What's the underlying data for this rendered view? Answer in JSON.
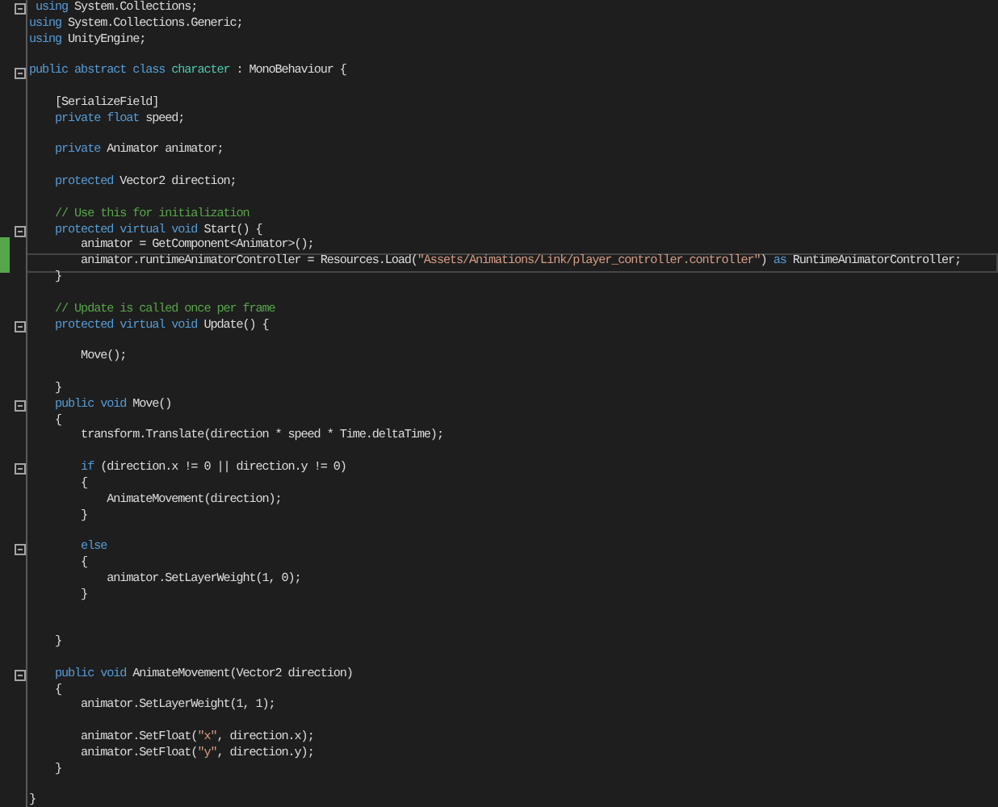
{
  "editor": {
    "lines": [
      {
        "tokens": [
          {
            "kind": "keyword",
            "text": " using"
          },
          {
            "kind": "plain",
            "text": " System.Collections;"
          }
        ],
        "foldable": true,
        "modified": false,
        "current": false
      },
      {
        "tokens": [
          {
            "kind": "keyword",
            "text": "using"
          },
          {
            "kind": "plain",
            "text": " System.Collections.Generic;"
          }
        ],
        "foldable": false,
        "modified": false,
        "current": false
      },
      {
        "tokens": [
          {
            "kind": "keyword",
            "text": "using"
          },
          {
            "kind": "plain",
            "text": " UnityEngine;"
          }
        ],
        "foldable": false,
        "modified": false,
        "current": false
      },
      {
        "foldable": false,
        "modified": false,
        "current": false
      },
      {
        "tokens": [
          {
            "kind": "keyword",
            "text": "public abstract class"
          },
          {
            "kind": "type",
            "text": " character"
          },
          {
            "kind": "plain",
            "text": " : MonoBehaviour {"
          }
        ],
        "foldable": true,
        "modified": false,
        "current": false
      },
      {
        "foldable": false,
        "modified": false,
        "current": false
      },
      {
        "tokens": [
          {
            "kind": "plain",
            "text": "    [SerializeField]"
          }
        ],
        "foldable": false,
        "modified": false,
        "current": false
      },
      {
        "tokens": [
          {
            "kind": "keyword",
            "text": "    private float"
          },
          {
            "kind": "plain",
            "text": " speed;"
          }
        ],
        "foldable": false,
        "modified": false,
        "current": false
      },
      {
        "foldable": false,
        "modified": false,
        "current": false
      },
      {
        "tokens": [
          {
            "kind": "keyword",
            "text": "    private"
          },
          {
            "kind": "plain",
            "text": " Animator animator;"
          }
        ],
        "foldable": false,
        "modified": false,
        "current": false
      },
      {
        "foldable": false,
        "modified": false,
        "current": false
      },
      {
        "tokens": [
          {
            "kind": "keyword",
            "text": "    protected"
          },
          {
            "kind": "plain",
            "text": " Vector2 direction;"
          }
        ],
        "foldable": false,
        "modified": false,
        "current": false
      },
      {
        "foldable": false,
        "modified": false,
        "current": false
      },
      {
        "tokens": [
          {
            "kind": "comment",
            "text": "    // Use this for initialization"
          }
        ],
        "foldable": false,
        "modified": false,
        "current": false
      },
      {
        "tokens": [
          {
            "kind": "keyword",
            "text": "    protected virtual void"
          },
          {
            "kind": "plain",
            "text": " Start() {"
          }
        ],
        "foldable": true,
        "modified": false,
        "current": false
      },
      {
        "tokens": [
          {
            "kind": "plain",
            "text": "        animator = GetComponent<Animator>();"
          }
        ],
        "foldable": false,
        "modified": true,
        "current": false
      },
      {
        "tokens": [
          {
            "kind": "plain",
            "text": "        animator.runtimeAnimatorController = Resources.Load("
          },
          {
            "kind": "string",
            "text": "\"Assets/Animations/Link/player_controller.controller\""
          },
          {
            "kind": "plain",
            "text": ") "
          },
          {
            "kind": "keyword",
            "text": "as"
          },
          {
            "kind": "plain",
            "text": " RuntimeAnimatorController;"
          }
        ],
        "foldable": false,
        "modified": true,
        "current": true
      },
      {
        "tokens": [
          {
            "kind": "plain",
            "text": "    }"
          }
        ],
        "foldable": false,
        "modified": false,
        "current": false
      },
      {
        "foldable": false,
        "modified": false,
        "current": false
      },
      {
        "tokens": [
          {
            "kind": "comment",
            "text": "    // Update is called once per frame"
          }
        ],
        "foldable": false,
        "modified": false,
        "current": false
      },
      {
        "tokens": [
          {
            "kind": "keyword",
            "text": "    protected virtual void"
          },
          {
            "kind": "plain",
            "text": " Update() {"
          }
        ],
        "foldable": true,
        "modified": false,
        "current": false
      },
      {
        "foldable": false,
        "modified": false,
        "current": false
      },
      {
        "tokens": [
          {
            "kind": "plain",
            "text": "        Move();"
          }
        ],
        "foldable": false,
        "modified": false,
        "current": false
      },
      {
        "foldable": false,
        "modified": false,
        "current": false
      },
      {
        "tokens": [
          {
            "kind": "plain",
            "text": "    }"
          }
        ],
        "foldable": false,
        "modified": false,
        "current": false
      },
      {
        "tokens": [
          {
            "kind": "keyword",
            "text": "    public void"
          },
          {
            "kind": "plain",
            "text": " Move()"
          }
        ],
        "foldable": true,
        "modified": false,
        "current": false
      },
      {
        "tokens": [
          {
            "kind": "plain",
            "text": "    {"
          }
        ],
        "foldable": false,
        "modified": false,
        "current": false
      },
      {
        "tokens": [
          {
            "kind": "plain",
            "text": "        transform.Translate(direction * speed * Time.deltaTime);"
          }
        ],
        "foldable": false,
        "modified": false,
        "current": false
      },
      {
        "foldable": false,
        "modified": false,
        "current": false
      },
      {
        "tokens": [
          {
            "kind": "keyword",
            "text": "        if"
          },
          {
            "kind": "plain",
            "text": " (direction.x != 0 || direction.y != 0)"
          }
        ],
        "foldable": true,
        "modified": false,
        "current": false
      },
      {
        "tokens": [
          {
            "kind": "plain",
            "text": "        {"
          }
        ],
        "foldable": false,
        "modified": false,
        "current": false
      },
      {
        "tokens": [
          {
            "kind": "plain",
            "text": "            AnimateMovement(direction);"
          }
        ],
        "foldable": false,
        "modified": false,
        "current": false
      },
      {
        "tokens": [
          {
            "kind": "plain",
            "text": "        }"
          }
        ],
        "foldable": false,
        "modified": false,
        "current": false
      },
      {
        "foldable": false,
        "modified": false,
        "current": false
      },
      {
        "tokens": [
          {
            "kind": "keyword",
            "text": "        else"
          }
        ],
        "foldable": true,
        "modified": false,
        "current": false
      },
      {
        "tokens": [
          {
            "kind": "plain",
            "text": "        {"
          }
        ],
        "foldable": false,
        "modified": false,
        "current": false
      },
      {
        "tokens": [
          {
            "kind": "plain",
            "text": "            animator.SetLayerWeight(1, 0);"
          }
        ],
        "foldable": false,
        "modified": false,
        "current": false
      },
      {
        "tokens": [
          {
            "kind": "plain",
            "text": "        }"
          }
        ],
        "foldable": false,
        "modified": false,
        "current": false
      },
      {
        "foldable": false,
        "modified": false,
        "current": false
      },
      {
        "foldable": false,
        "modified": false,
        "current": false
      },
      {
        "tokens": [
          {
            "kind": "plain",
            "text": "    }"
          }
        ],
        "foldable": false,
        "modified": false,
        "current": false
      },
      {
        "foldable": false,
        "modified": false,
        "current": false
      },
      {
        "tokens": [
          {
            "kind": "keyword",
            "text": "    public void"
          },
          {
            "kind": "plain",
            "text": " AnimateMovement(Vector2 direction)"
          }
        ],
        "foldable": true,
        "modified": false,
        "current": false
      },
      {
        "tokens": [
          {
            "kind": "plain",
            "text": "    {"
          }
        ],
        "foldable": false,
        "modified": false,
        "current": false
      },
      {
        "tokens": [
          {
            "kind": "plain",
            "text": "        animator.SetLayerWeight(1, 1);"
          }
        ],
        "foldable": false,
        "modified": false,
        "current": false
      },
      {
        "foldable": false,
        "modified": false,
        "current": false
      },
      {
        "tokens": [
          {
            "kind": "plain",
            "text": "        animator.SetFloat("
          },
          {
            "kind": "string",
            "text": "\"x\""
          },
          {
            "kind": "plain",
            "text": ", direction.x);"
          }
        ],
        "foldable": false,
        "modified": false,
        "current": false
      },
      {
        "tokens": [
          {
            "kind": "plain",
            "text": "        animator.SetFloat("
          },
          {
            "kind": "string",
            "text": "\"y\""
          },
          {
            "kind": "plain",
            "text": ", direction.y);"
          }
        ],
        "foldable": false,
        "modified": false,
        "current": false
      },
      {
        "tokens": [
          {
            "kind": "plain",
            "text": "    }"
          }
        ],
        "foldable": false,
        "modified": false,
        "current": false
      },
      {
        "foldable": false,
        "modified": false,
        "current": false
      },
      {
        "tokens": [
          {
            "kind": "plain",
            "text": "}"
          }
        ],
        "foldable": false,
        "modified": false,
        "current": false
      }
    ]
  }
}
